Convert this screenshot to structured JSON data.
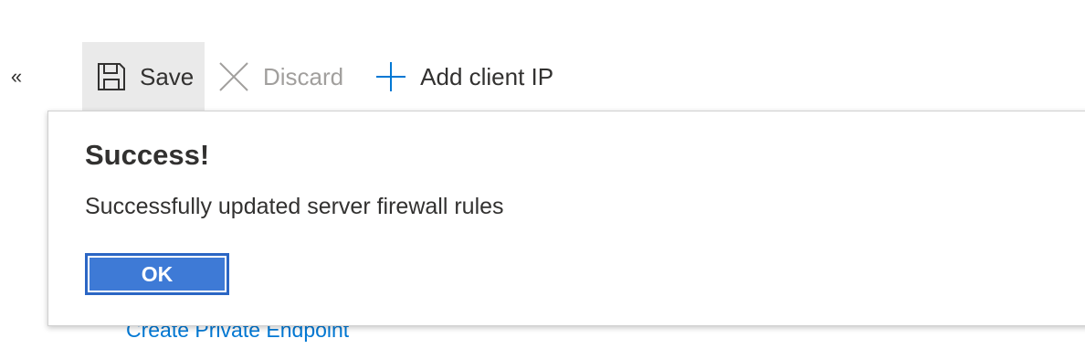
{
  "nav": {
    "collapse_glyph": "«"
  },
  "toolbar": {
    "save_label": "Save",
    "discard_label": "Discard",
    "add_client_ip_label": "Add client IP"
  },
  "background": {
    "link_label": "Create Private Endpoint"
  },
  "dialog": {
    "title": "Success!",
    "message": "Successfully updated server firewall rules",
    "ok_label": "OK"
  },
  "colors": {
    "accent_blue": "#0078d4",
    "ok_button_fill": "#3e7ad6",
    "ok_button_border": "#2b66c4",
    "save_button_bg": "#eaeaea",
    "disabled_text": "#a19f9d"
  },
  "icons": {
    "save": "floppy-disk-icon",
    "discard": "close-icon",
    "add": "plus-icon"
  }
}
